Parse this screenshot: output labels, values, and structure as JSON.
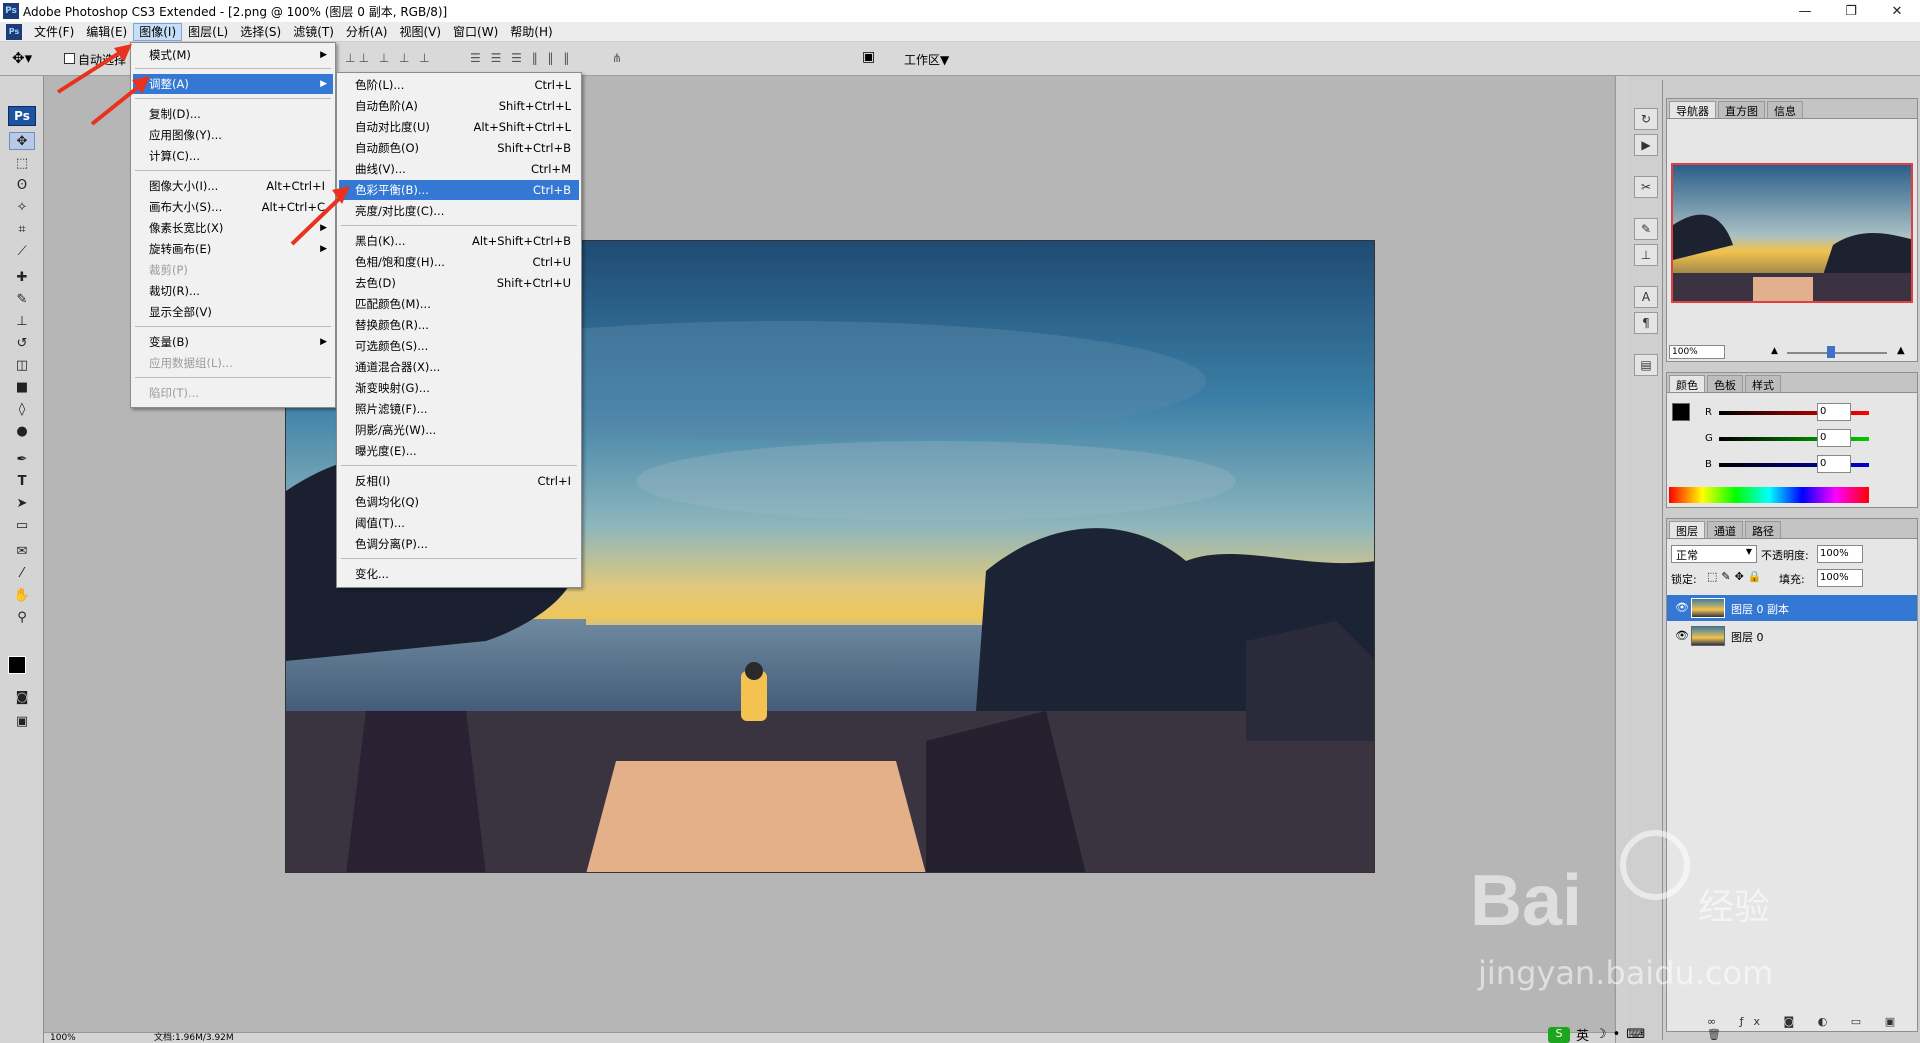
{
  "titlebar": {
    "title": "Adobe Photoshop CS3 Extended - [2.png @ 100% (图层 0 副本, RGB/8)]",
    "app_icon": "Ps",
    "minimize": "—",
    "restore": "❐",
    "close": "✕"
  },
  "menubar": {
    "icon": "Ps",
    "items": [
      "文件(F)",
      "编辑(E)",
      "图像(I)",
      "图层(L)",
      "选择(S)",
      "滤镜(T)",
      "分析(A)",
      "视图(V)",
      "窗口(W)",
      "帮助(H)"
    ],
    "doc_controls": [
      "_",
      "▫",
      "×"
    ]
  },
  "options": {
    "auto_select": "自动选择",
    "workspace": "工作区▼"
  },
  "image_menu": {
    "items": [
      {
        "label": "模式(M)",
        "shortcut": "",
        "submenu": true,
        "disabled": false
      },
      {
        "label": "调整(A)",
        "shortcut": "",
        "submenu": true,
        "disabled": false,
        "highlighted": true
      },
      {
        "label": "复制(D)...",
        "shortcut": "",
        "submenu": false,
        "disabled": false
      },
      {
        "label": "应用图像(Y)...",
        "shortcut": "",
        "submenu": false,
        "disabled": false
      },
      {
        "label": "计算(C)...",
        "shortcut": "",
        "submenu": false,
        "disabled": false
      },
      {
        "label": "图像大小(I)...",
        "shortcut": "Alt+Ctrl+I",
        "submenu": false,
        "disabled": false
      },
      {
        "label": "画布大小(S)...",
        "shortcut": "Alt+Ctrl+C",
        "submenu": false,
        "disabled": false
      },
      {
        "label": "像素长宽比(X)",
        "shortcut": "",
        "submenu": true,
        "disabled": false
      },
      {
        "label": "旋转画布(E)",
        "shortcut": "",
        "submenu": true,
        "disabled": false
      },
      {
        "label": "裁剪(P)",
        "shortcut": "",
        "submenu": false,
        "disabled": true
      },
      {
        "label": "裁切(R)...",
        "shortcut": "",
        "submenu": false,
        "disabled": false
      },
      {
        "label": "显示全部(V)",
        "shortcut": "",
        "submenu": false,
        "disabled": false
      },
      {
        "label": "变量(B)",
        "shortcut": "",
        "submenu": true,
        "disabled": false
      },
      {
        "label": "应用数据组(L)...",
        "shortcut": "",
        "submenu": false,
        "disabled": true
      },
      {
        "label": "陷印(T)...",
        "shortcut": "",
        "submenu": false,
        "disabled": true
      }
    ]
  },
  "adjust_menu": {
    "items": [
      {
        "label": "色阶(L)...",
        "shortcut": "Ctrl+L"
      },
      {
        "label": "自动色阶(A)",
        "shortcut": "Shift+Ctrl+L"
      },
      {
        "label": "自动对比度(U)",
        "shortcut": "Alt+Shift+Ctrl+L"
      },
      {
        "label": "自动颜色(O)",
        "shortcut": "Shift+Ctrl+B"
      },
      {
        "label": "曲线(V)...",
        "shortcut": "Ctrl+M"
      },
      {
        "label": "色彩平衡(B)...",
        "shortcut": "Ctrl+B",
        "highlighted": true
      },
      {
        "label": "亮度/对比度(C)...",
        "shortcut": ""
      },
      {
        "label": "黑白(K)...",
        "shortcut": "Alt+Shift+Ctrl+B"
      },
      {
        "label": "色相/饱和度(H)...",
        "shortcut": "Ctrl+U"
      },
      {
        "label": "去色(D)",
        "shortcut": "Shift+Ctrl+U"
      },
      {
        "label": "匹配颜色(M)...",
        "shortcut": ""
      },
      {
        "label": "替换颜色(R)...",
        "shortcut": ""
      },
      {
        "label": "可选颜色(S)...",
        "shortcut": ""
      },
      {
        "label": "通道混合器(X)...",
        "shortcut": ""
      },
      {
        "label": "渐变映射(G)...",
        "shortcut": ""
      },
      {
        "label": "照片滤镜(F)...",
        "shortcut": ""
      },
      {
        "label": "阴影/高光(W)...",
        "shortcut": ""
      },
      {
        "label": "曝光度(E)...",
        "shortcut": ""
      },
      {
        "label": "反相(I)",
        "shortcut": "Ctrl+I"
      },
      {
        "label": "色调均化(Q)",
        "shortcut": ""
      },
      {
        "label": "阈值(T)...",
        "shortcut": ""
      },
      {
        "label": "色调分离(P)...",
        "shortcut": ""
      },
      {
        "label": "变化...",
        "shortcut": ""
      }
    ]
  },
  "navigator": {
    "tabs": [
      "导航器",
      "直方图",
      "信息"
    ],
    "zoom": "100%"
  },
  "color_panel": {
    "tabs": [
      "颜色",
      "色板",
      "样式"
    ],
    "channels": [
      {
        "name": "R",
        "value": "0"
      },
      {
        "name": "G",
        "value": "0"
      },
      {
        "name": "B",
        "value": "0"
      }
    ]
  },
  "layers_panel": {
    "tabs": [
      "图层",
      "通道",
      "路径"
    ],
    "blend_mode": "正常",
    "opacity_label": "不透明度:",
    "opacity": "100%",
    "lock_label": "锁定:",
    "fill_label": "填充:",
    "fill": "100%",
    "layers": [
      {
        "name": "图层 0 副本",
        "selected": true
      },
      {
        "name": "图层 0",
        "selected": false
      }
    ]
  },
  "status": {
    "zoom": "100%",
    "doc": "文档:1.96M/3.92M"
  },
  "ime": {
    "lang": "英"
  },
  "watermark": {
    "brand": "Bai",
    "brand2": "经验",
    "url": "jingyan.baidu.com"
  },
  "colors": {
    "highlight": "#3478d3",
    "annotation_arrow": "#e8321e"
  }
}
